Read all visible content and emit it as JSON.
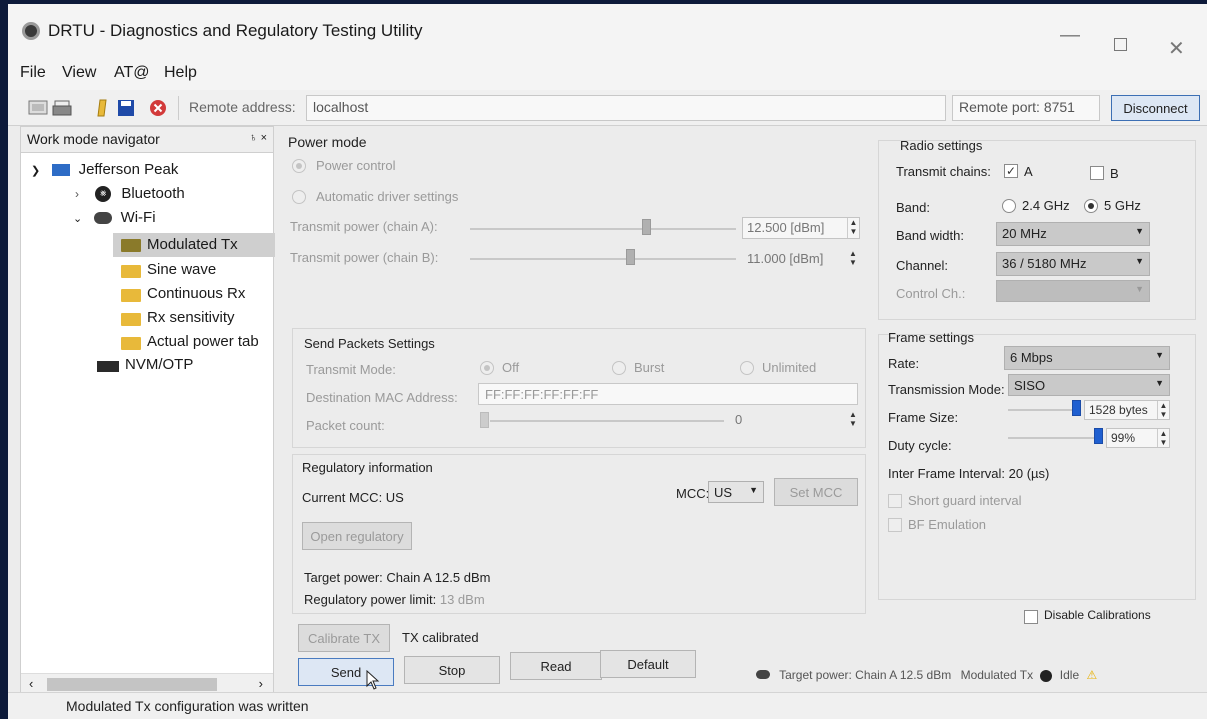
{
  "app": {
    "title": "DRTU - Diagnostics and Regulatory Testing Utility"
  },
  "menu": [
    "File",
    "View",
    "AT@",
    "Help"
  ],
  "toolbar": {
    "remote_address_label": "Remote address:",
    "remote_address_value": "localhost",
    "remote_port_label": "Remote port:",
    "remote_port_value": "8751",
    "disconnect_label": "Disconnect"
  },
  "navigator": {
    "title": "Work mode navigator",
    "pin": "♄ ×",
    "items": [
      {
        "label": "Jefferson Peak"
      },
      {
        "label": "Bluetooth"
      },
      {
        "label": "Wi-Fi"
      },
      {
        "label": "Modulated Tx"
      },
      {
        "label": "Sine wave"
      },
      {
        "label": "Continuous Rx"
      },
      {
        "label": "Rx sensitivity"
      },
      {
        "label": "Actual power tab"
      },
      {
        "label": "NVM/OTP"
      }
    ]
  },
  "power_mode": {
    "title": "Power mode",
    "power_control": "Power control",
    "automatic": "Automatic driver settings",
    "chain_a_label": "Transmit power (chain A):",
    "chain_a_value": "12.500 [dBm]",
    "chain_b_label": "Transmit power (chain B):",
    "chain_b_value": "11.000 [dBm]"
  },
  "send_packets": {
    "title": "Send Packets Settings",
    "transmit_mode_label": "Transmit Mode:",
    "mode_off": "Off",
    "mode_burst": "Burst",
    "mode_unlimited": "Unlimited",
    "dest_mac_label": "Destination MAC Address:",
    "dest_mac_value": "FF:FF:FF:FF:FF:FF",
    "packet_count_label": "Packet count:",
    "packet_count_value": "0"
  },
  "regulatory": {
    "title": "Regulatory information",
    "current_mcc": "Current MCC: US",
    "mcc_label": "MCC:",
    "mcc_value": "US",
    "set_mcc": "Set MCC",
    "open_regulatory": "Open regulatory",
    "target_power": "Target power: Chain A 12.5 dBm",
    "limit_label": "Regulatory power limit:",
    "limit_value": "13 dBm"
  },
  "calibrate": {
    "button": "Calibrate TX",
    "status": "TX calibrated"
  },
  "actions": {
    "send": "Send",
    "stop": "Stop",
    "read": "Read",
    "default": "Default"
  },
  "radio": {
    "title": "Radio settings",
    "transmit_chains_label": "Transmit chains:",
    "chain_a": "A",
    "chain_b": "B",
    "band_label": "Band:",
    "band_24": "2.4 GHz",
    "band_5": "5 GHz",
    "bandwidth_label": "Band width:",
    "bandwidth_value": "20 MHz",
    "channel_label": "Channel:",
    "channel_value": "36 / 5180 MHz",
    "control_ch_label": "Control Ch.:"
  },
  "frame": {
    "title": "Frame settings",
    "rate_label": "Rate:",
    "rate_value": "6 Mbps",
    "tx_mode_label": "Transmission Mode:",
    "tx_mode_value": "SISO",
    "frame_size_label": "Frame Size:",
    "frame_size_value": "1528 bytes",
    "duty_label": "Duty cycle:",
    "duty_value": "99%",
    "ifi": "Inter Frame Interval: 20 (µs)",
    "short_guard": "Short guard interval",
    "bf_emulation": "BF Emulation"
  },
  "disable_calibrations": "Disable Calibrations",
  "status": {
    "message": "Modulated Tx configuration was written",
    "target_power": "Target power: Chain A 12.5 dBm",
    "mode": "Modulated Tx",
    "state": "Idle"
  }
}
